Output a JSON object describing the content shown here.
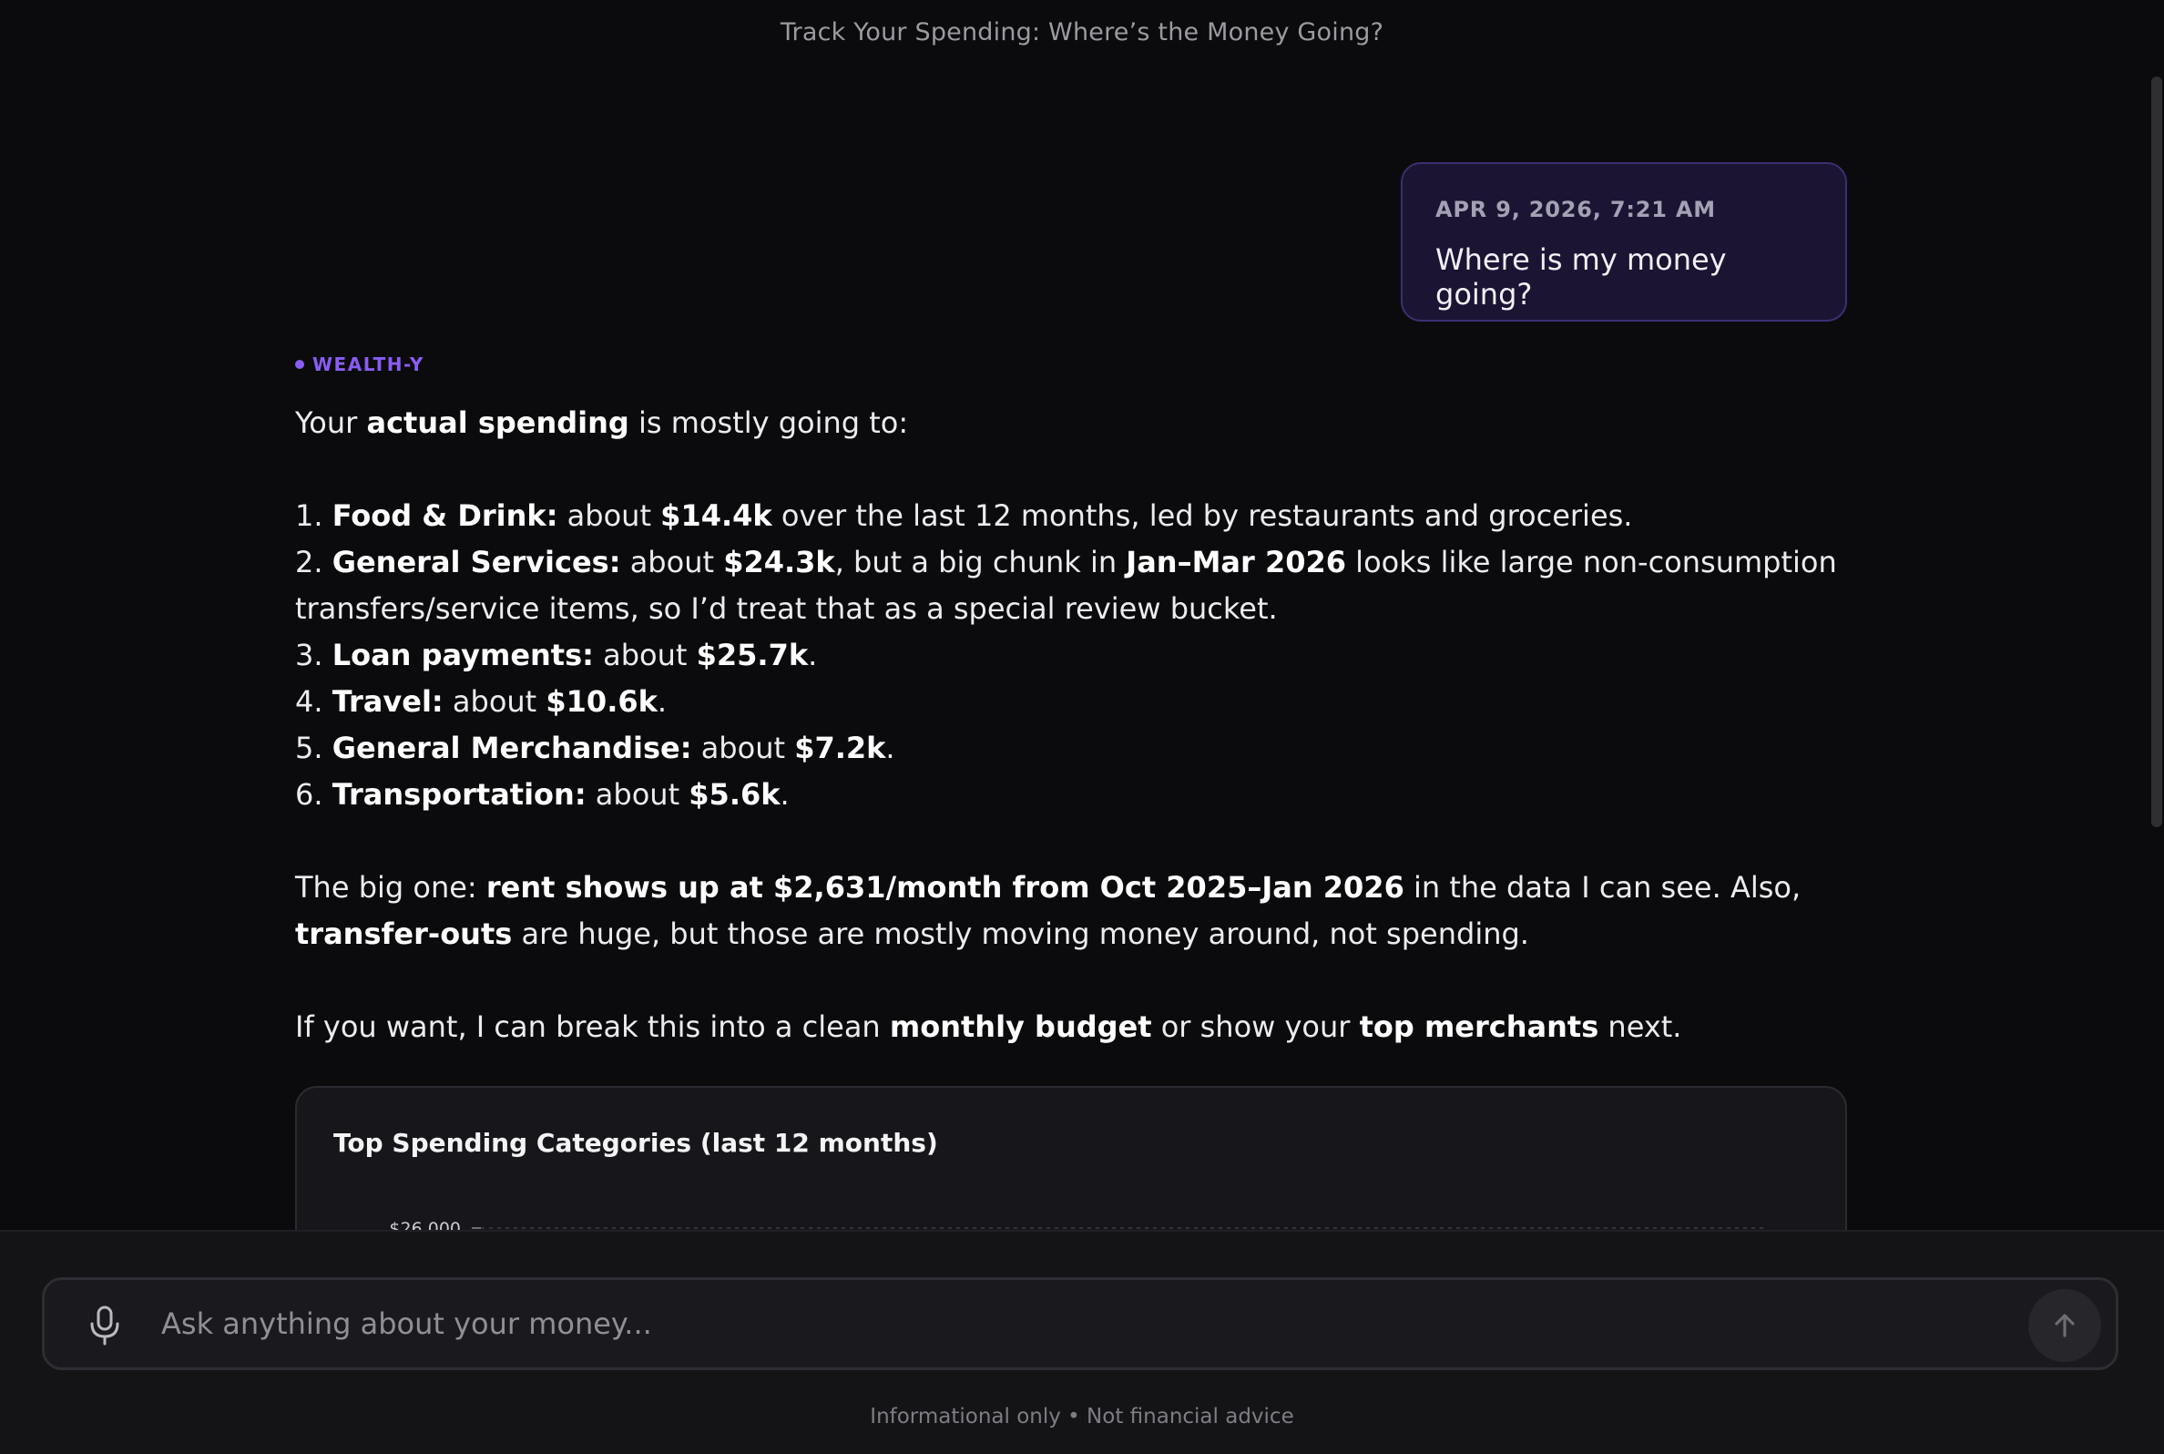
{
  "header": {
    "title": "Track Your Spending: Where’s the Money Going?"
  },
  "user_message": {
    "timestamp": "APR 9, 2026, 7:21 AM",
    "text": "Where is my money going?"
  },
  "assistant": {
    "name": "WEALTH-Y",
    "intro": {
      "p1": "Your ",
      "b1": "actual spending",
      "p2": " is mostly going to:"
    },
    "items": [
      {
        "n": "1. ",
        "b1": "Food & Drink:",
        "p1": " about ",
        "b2": "$14.4k",
        "p2": " over the last 12 months, led by restaurants and groceries.",
        "b3": "",
        "p3": ""
      },
      {
        "n": "2. ",
        "b1": "General Services:",
        "p1": " about ",
        "b2": "$24.3k",
        "p2": ", but a big chunk in ",
        "b3": "Jan–Mar 2026",
        "p3": " looks like large non-consumption transfers/service items, so I’d treat that as a special review bucket."
      },
      {
        "n": "3. ",
        "b1": "Loan payments:",
        "p1": " about ",
        "b2": "$25.7k",
        "p2": ".",
        "b3": "",
        "p3": ""
      },
      {
        "n": "4. ",
        "b1": "Travel:",
        "p1": " about ",
        "b2": "$10.6k",
        "p2": ".",
        "b3": "",
        "p3": ""
      },
      {
        "n": "5. ",
        "b1": "General Merchandise:",
        "p1": " about ",
        "b2": "$7.2k",
        "p2": ".",
        "b3": "",
        "p3": ""
      },
      {
        "n": "6. ",
        "b1": "Transportation:",
        "p1": " about ",
        "b2": "$5.6k",
        "p2": ".",
        "b3": "",
        "p3": ""
      }
    ],
    "big_one": {
      "p1": "The big one: ",
      "b1": "rent shows up at $2,631/month from Oct 2025–Jan 2026",
      "p2": " in the data I can see. Also, ",
      "b2": "transfer-outs",
      "p3": " are huge, but those are mostly moving money around, not spending."
    },
    "closing": {
      "p1": "If you want, I can break this into a clean ",
      "b1": "monthly budget",
      "p2": " or show your ",
      "b2": "top merchants",
      "p3": " next."
    }
  },
  "chart_card": {
    "title": "Top Spending Categories (last 12 months)"
  },
  "chart_data": {
    "type": "bar",
    "title": "Top Spending Categories (last 12 months)",
    "y_ticks_visible": [
      "$26,000"
    ],
    "grid": true
  },
  "composer": {
    "placeholder": "Ask anything about your money...",
    "mic_icon": "microphone-icon",
    "send_icon": "arrow-up-icon"
  },
  "footer": {
    "disclaimer": "Informational only • Not financial advice"
  }
}
